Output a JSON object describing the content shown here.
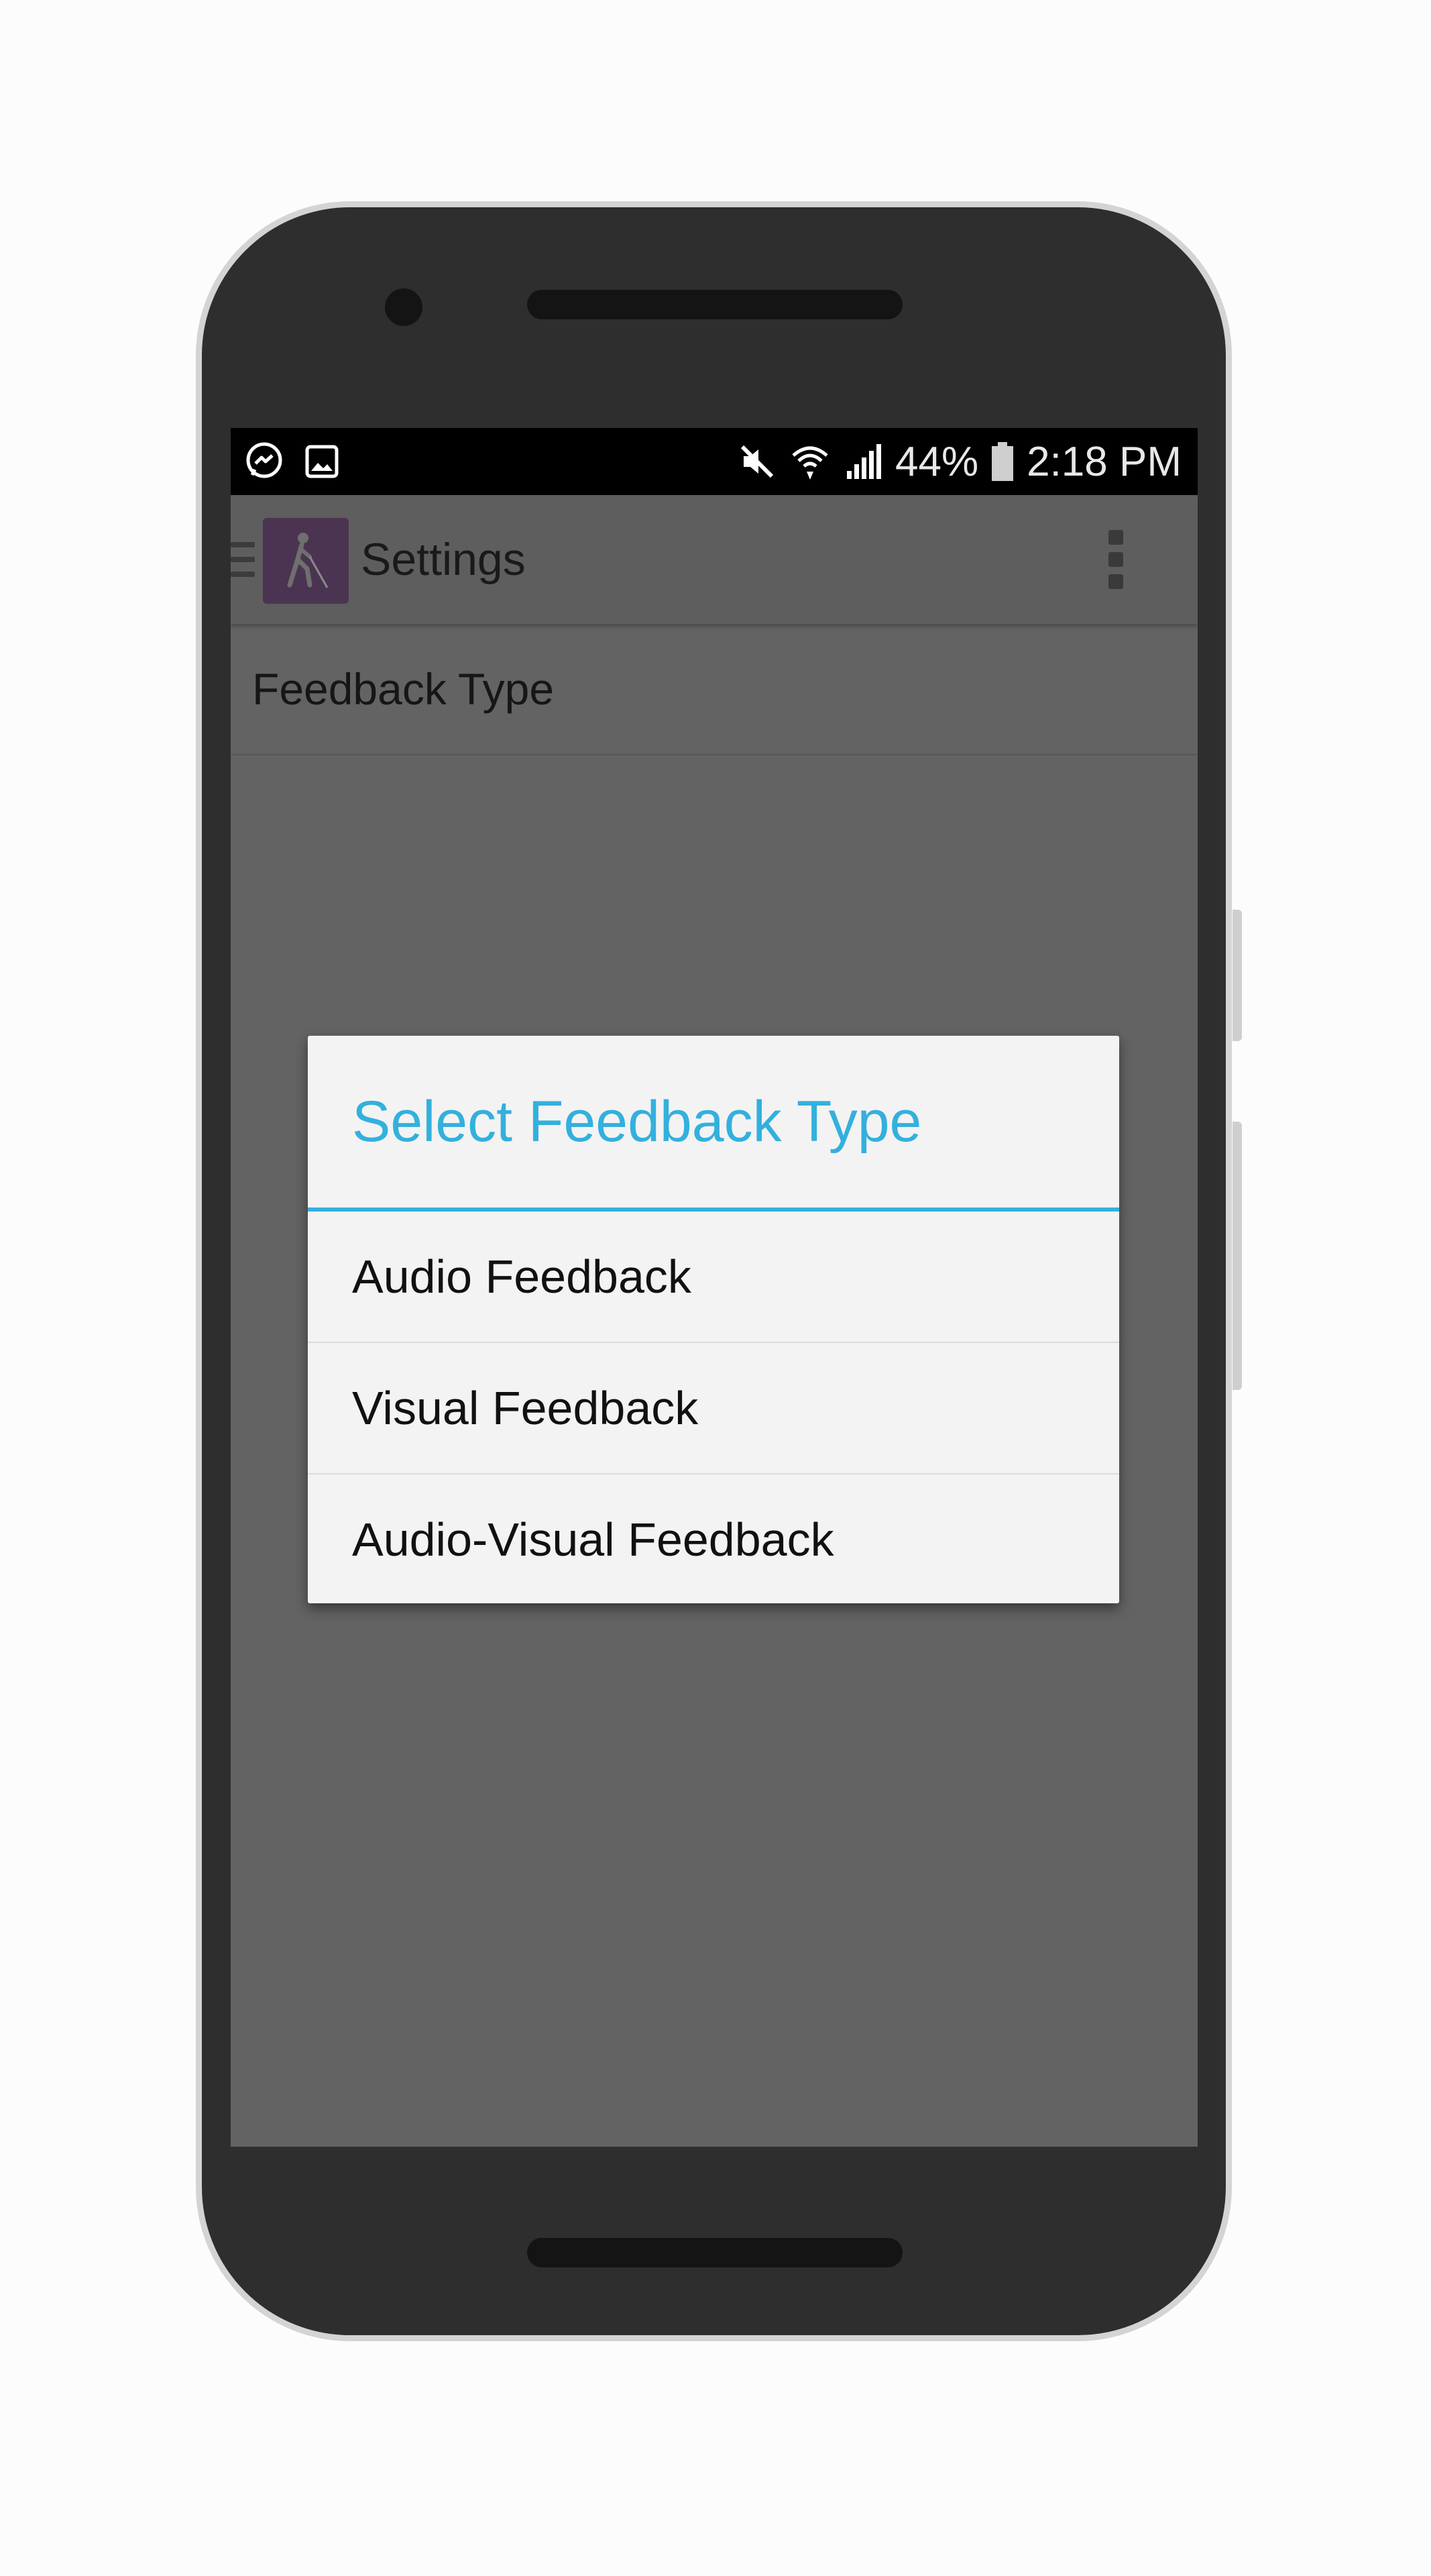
{
  "status_bar": {
    "notification_icons": [
      "messenger-icon",
      "gallery-icon"
    ],
    "system_icons": [
      "mute-icon",
      "wifi-icon",
      "signal-icon",
      "battery-icon"
    ],
    "battery": "44%",
    "time": "2:18 PM"
  },
  "app_bar": {
    "title": "Settings",
    "app_icon": "blind-person-icon",
    "menu_icon": "overflow-menu-icon"
  },
  "settings": {
    "items": [
      {
        "label": "Feedback Type"
      }
    ]
  },
  "dialog": {
    "title": "Select Feedback Type",
    "options": [
      {
        "label": "Audio Feedback"
      },
      {
        "label": "Visual Feedback"
      },
      {
        "label": "Audio-Visual Feedback"
      }
    ]
  },
  "colors": {
    "accent": "#33b0dd",
    "app_icon_bg": "#4b3451",
    "scrim_bg": "#636363"
  }
}
